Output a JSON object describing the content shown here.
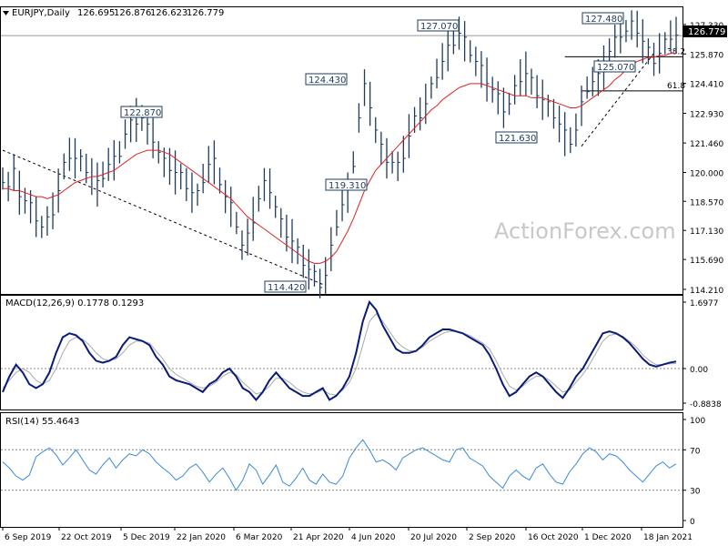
{
  "chart_data": {
    "type": "line",
    "symbol": "EURJPY,Daily",
    "ohlc": [
      "126.695",
      "126.876",
      "126.623",
      "126.779"
    ],
    "watermark": "ActionForex.com",
    "x_labels": [
      "6 Sep 2019",
      "22 Oct 2019",
      "5 Dec 2019",
      "22 Jan 2020",
      "6 Mar 2020",
      "21 Apr 2020",
      "4 Jun 2020",
      "20 Jul 2020",
      "2 Sep 2020",
      "16 Oct 2020",
      "1 Dec 2020",
      "18 Jan 2021"
    ],
    "price_panel": {
      "ticks": [
        "127.330",
        "125.870",
        "124.410",
        "122.930",
        "121.460",
        "120.000",
        "118.570",
        "117.130",
        "115.690",
        "114.210"
      ],
      "ylim": [
        114.21,
        127.55
      ],
      "current": "126.779",
      "series": [
        {
          "name": "price",
          "values": [
            119.7,
            119.3,
            120.0,
            119.0,
            118.6,
            118.3,
            117.8,
            117.3,
            117.6,
            118.1,
            119.1,
            120.3,
            120.9,
            120.7,
            120.6,
            120.2,
            119.8,
            119.4,
            119.9,
            120.4,
            120.6,
            121.0,
            121.9,
            122.4,
            122.6,
            122.7,
            122.2,
            121.7,
            121.0,
            120.5,
            120.3,
            120.0,
            119.8,
            119.4,
            119.0,
            118.9,
            119.7,
            120.4,
            120.5,
            119.6,
            118.8,
            118.3,
            117.5,
            116.4,
            116.8,
            117.7,
            118.7,
            119.4,
            119.2,
            118.3,
            117.5,
            117.0,
            116.6,
            116.1,
            115.6,
            115.2,
            114.9,
            114.5,
            114.9,
            116.2,
            117.5,
            118.4,
            119.0,
            120.5,
            122.7,
            124.2,
            123.4,
            122.1,
            121.2,
            120.7,
            120.5,
            120.3,
            120.9,
            121.8,
            122.6,
            122.9,
            123.4,
            124.2,
            124.9,
            125.5,
            126.1,
            126.5,
            126.9,
            126.5,
            126.0,
            125.5,
            125.1,
            124.6,
            124.1,
            123.7,
            123.2,
            123.4,
            124.1,
            124.7,
            124.9,
            124.5,
            124.0,
            123.6,
            123.3,
            122.9,
            122.4,
            121.9,
            121.6,
            122.1,
            123.3,
            124.2,
            124.5,
            124.7,
            125.2,
            126.0,
            126.5,
            126.9,
            127.0,
            127.3,
            127.1,
            126.5,
            126.0,
            125.6,
            125.9,
            126.4,
            126.8,
            126.8
          ]
        },
        {
          "name": "ma",
          "values": [
            119.2,
            119.2,
            119.1,
            119.1,
            119.0,
            118.9,
            118.8,
            118.8,
            118.7,
            118.8,
            118.9,
            119.1,
            119.3,
            119.5,
            119.6,
            119.7,
            119.8,
            119.8,
            119.9,
            120.0,
            120.1,
            120.3,
            120.5,
            120.7,
            120.9,
            121.0,
            121.1,
            121.1,
            121.1,
            121.0,
            120.9,
            120.7,
            120.5,
            120.3,
            120.1,
            119.9,
            119.7,
            119.5,
            119.3,
            119.1,
            118.9,
            118.7,
            118.4,
            118.1,
            117.8,
            117.6,
            117.4,
            117.2,
            117.0,
            116.8,
            116.6,
            116.4,
            116.2,
            116.0,
            115.8,
            115.6,
            115.5,
            115.5,
            115.6,
            115.8,
            116.1,
            116.6,
            117.1,
            117.7,
            118.4,
            119.1,
            119.6,
            120.1,
            120.4,
            120.7,
            121.0,
            121.3,
            121.6,
            121.9,
            122.2,
            122.5,
            122.8,
            123.1,
            123.3,
            123.6,
            123.8,
            124.0,
            124.2,
            124.3,
            124.4,
            124.4,
            124.4,
            124.3,
            124.2,
            124.1,
            124.0,
            123.9,
            123.8,
            123.8,
            123.8,
            123.7,
            123.7,
            123.7,
            123.6,
            123.5,
            123.4,
            123.3,
            123.2,
            123.2,
            123.3,
            123.5,
            123.7,
            123.9,
            124.1,
            124.3,
            124.6,
            124.8,
            125.1,
            125.3,
            125.5,
            125.6,
            125.7,
            125.7,
            125.8,
            125.8,
            125.9,
            125.9
          ]
        }
      ],
      "annotations": [
        "127.480",
        "127.070",
        "122.870",
        "124.430",
        "119.310",
        "114.420",
        "125.070",
        "121.630"
      ],
      "fib_levels": [
        {
          "label": "38.2",
          "value": 125.73
        },
        {
          "label": "61.8",
          "value": 124.04
        }
      ],
      "trendline_down": {
        "from": [
          0,
          121.1
        ],
        "to": [
          58,
          114.4
        ]
      },
      "trendline_up": {
        "from": [
          104,
          121.3
        ],
        "to": [
          117,
          125.9
        ]
      }
    },
    "macd_panel": {
      "label": "MACD(12,26,9) 0.1778 0.1293",
      "ticks": [
        "1.6977",
        "0.00",
        "-0.8838"
      ],
      "ylim": [
        -0.8838,
        1.6977
      ],
      "macd": [
        -0.6,
        -0.2,
        0.1,
        -0.1,
        -0.4,
        -0.5,
        -0.4,
        -0.1,
        0.4,
        0.8,
        0.9,
        0.85,
        0.7,
        0.4,
        0.2,
        0.15,
        0.2,
        0.3,
        0.6,
        0.8,
        0.75,
        0.7,
        0.6,
        0.3,
        0.1,
        -0.2,
        -0.3,
        -0.35,
        -0.4,
        -0.5,
        -0.6,
        -0.4,
        -0.3,
        -0.1,
        0.0,
        -0.2,
        -0.5,
        -0.6,
        -0.8,
        -0.6,
        -0.3,
        -0.1,
        -0.3,
        -0.5,
        -0.6,
        -0.7,
        -0.7,
        -0.6,
        -0.5,
        -0.8,
        -0.7,
        -0.5,
        -0.2,
        0.4,
        1.2,
        1.7,
        1.5,
        1.1,
        0.8,
        0.5,
        0.4,
        0.4,
        0.45,
        0.6,
        0.8,
        0.9,
        1.0,
        1.0,
        0.95,
        0.9,
        0.8,
        0.7,
        0.6,
        0.35,
        0.0,
        -0.4,
        -0.7,
        -0.6,
        -0.4,
        -0.2,
        -0.1,
        -0.2,
        -0.4,
        -0.6,
        -0.75,
        -0.5,
        -0.2,
        0.0,
        0.3,
        0.6,
        0.9,
        0.95,
        0.9,
        0.8,
        0.65,
        0.45,
        0.25,
        0.1,
        0.05,
        0.1,
        0.15,
        0.18
      ],
      "signal": [
        -0.5,
        -0.3,
        -0.1,
        0.0,
        -0.1,
        -0.3,
        -0.4,
        -0.3,
        0.0,
        0.4,
        0.7,
        0.8,
        0.75,
        0.6,
        0.4,
        0.25,
        0.2,
        0.25,
        0.4,
        0.6,
        0.7,
        0.7,
        0.65,
        0.45,
        0.25,
        0.0,
        -0.15,
        -0.25,
        -0.35,
        -0.45,
        -0.5,
        -0.45,
        -0.35,
        -0.2,
        -0.1,
        -0.15,
        -0.35,
        -0.5,
        -0.65,
        -0.6,
        -0.45,
        -0.25,
        -0.25,
        -0.35,
        -0.5,
        -0.6,
        -0.65,
        -0.62,
        -0.55,
        -0.65,
        -0.68,
        -0.55,
        -0.35,
        0.0,
        0.6,
        1.2,
        1.4,
        1.2,
        0.95,
        0.7,
        0.55,
        0.45,
        0.45,
        0.55,
        0.7,
        0.8,
        0.9,
        0.95,
        0.95,
        0.9,
        0.85,
        0.75,
        0.65,
        0.5,
        0.2,
        -0.15,
        -0.45,
        -0.55,
        -0.45,
        -0.3,
        -0.2,
        -0.2,
        -0.3,
        -0.45,
        -0.6,
        -0.55,
        -0.35,
        -0.15,
        0.1,
        0.4,
        0.7,
        0.85,
        0.88,
        0.82,
        0.7,
        0.55,
        0.35,
        0.2,
        0.1,
        0.1,
        0.12,
        0.13
      ]
    },
    "rsi_panel": {
      "label": "RSI(14) 55.4643",
      "ticks": [
        "100",
        "70",
        "30",
        "0"
      ],
      "ylim": [
        0,
        100
      ],
      "levels": [
        70,
        30
      ],
      "values": [
        58,
        52,
        44,
        40,
        45,
        63,
        68,
        72,
        65,
        55,
        62,
        70,
        60,
        50,
        46,
        55,
        62,
        52,
        60,
        66,
        64,
        70,
        66,
        58,
        52,
        47,
        40,
        44,
        52,
        56,
        48,
        38,
        46,
        52,
        42,
        30,
        40,
        56,
        50,
        36,
        45,
        55,
        38,
        34,
        42,
        52,
        40,
        36,
        46,
        38,
        36,
        44,
        62,
        72,
        80,
        70,
        58,
        60,
        56,
        50,
        62,
        66,
        70,
        72,
        68,
        64,
        60,
        58,
        70,
        72,
        62,
        58,
        54,
        44,
        38,
        32,
        44,
        50,
        44,
        40,
        52,
        56,
        46,
        38,
        36,
        48,
        56,
        66,
        72,
        68,
        60,
        66,
        64,
        58,
        50,
        44,
        38,
        46,
        54,
        58,
        52,
        56
      ]
    }
  }
}
